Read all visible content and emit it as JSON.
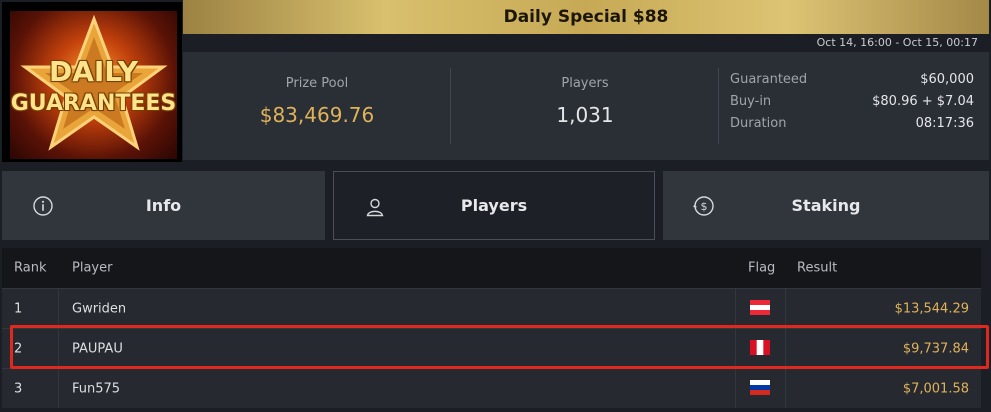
{
  "logo": {
    "line1": "DAILY",
    "line2": "GUARANTEES"
  },
  "title": "Daily Special $88",
  "datetime": "Oct 14, 16:00 - Oct 15, 00:17",
  "stats": {
    "prize_pool_label": "Prize Pool",
    "prize_pool_value": "$83,469.76",
    "players_label": "Players",
    "players_value": "1,031"
  },
  "details": [
    {
      "key": "Guaranteed",
      "value": "$60,000"
    },
    {
      "key": "Buy-in",
      "value": "$80.96 + $7.04"
    },
    {
      "key": "Duration",
      "value": "08:17:36"
    }
  ],
  "tabs": [
    {
      "label": "Info",
      "icon": "info-icon"
    },
    {
      "label": "Players",
      "icon": "user-icon",
      "active": true
    },
    {
      "label": "Staking",
      "icon": "dollar-circle-icon"
    }
  ],
  "table": {
    "headers": {
      "rank": "Rank",
      "player": "Player",
      "flag": "Flag",
      "result": "Result"
    },
    "rows": [
      {
        "rank": "1",
        "player": "Gwriden",
        "flag": "austria",
        "result": "$13,544.29"
      },
      {
        "rank": "2",
        "player": "PAUPAU",
        "flag": "peru",
        "result": "$9,737.84",
        "highlighted": true
      },
      {
        "rank": "3",
        "player": "Fun575",
        "flag": "russia",
        "result": "$7,001.58"
      }
    ]
  },
  "colors": {
    "gold": "#e0b25a",
    "highlight": "#e0281e",
    "title_bar": "#c7a955"
  }
}
